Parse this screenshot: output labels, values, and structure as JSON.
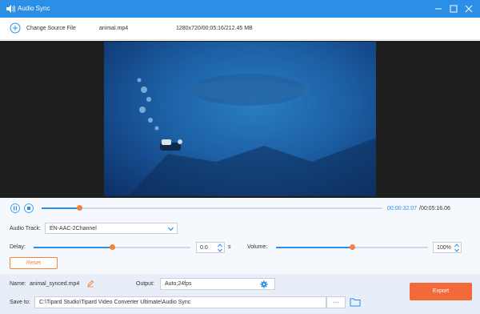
{
  "window": {
    "title": "Audio Sync",
    "icons": [
      "speaker-icon",
      "minimize-icon",
      "maximize-icon",
      "close-icon"
    ]
  },
  "file_bar": {
    "change_source_label": "Change Source File",
    "filename": "animal.mp4",
    "file_info": "1280x720/00:05:16/212.45 MB"
  },
  "playback": {
    "current_time": "00:00:32.07",
    "total_time": "/00:05:16.06",
    "progress_fraction": 0.11
  },
  "audio": {
    "track_label": "Audio Track:",
    "track_value": "EN-AAC-2Channel",
    "delay_label": "Delay:",
    "delay_value": "0.0",
    "delay_unit": "s",
    "delay_slider_fraction": 0.5,
    "volume_label": "Volume:",
    "volume_value": "100%",
    "volume_slider_fraction": 0.5,
    "reset_label": "Reset"
  },
  "output": {
    "name_label": "Name:",
    "name_value": "animal_synced.mp4",
    "output_label": "Output:",
    "output_value": "Auto;24fps",
    "save_label": "Save to:",
    "save_path": "C:\\Tipard Studio\\Tipard Video Converter Ultimate\\Audio Sync",
    "browse_label": "···",
    "export_label": "Export"
  },
  "colors": {
    "accent": "#2b8fe8",
    "orange": "#f5823c",
    "export": "#f26a3a"
  }
}
